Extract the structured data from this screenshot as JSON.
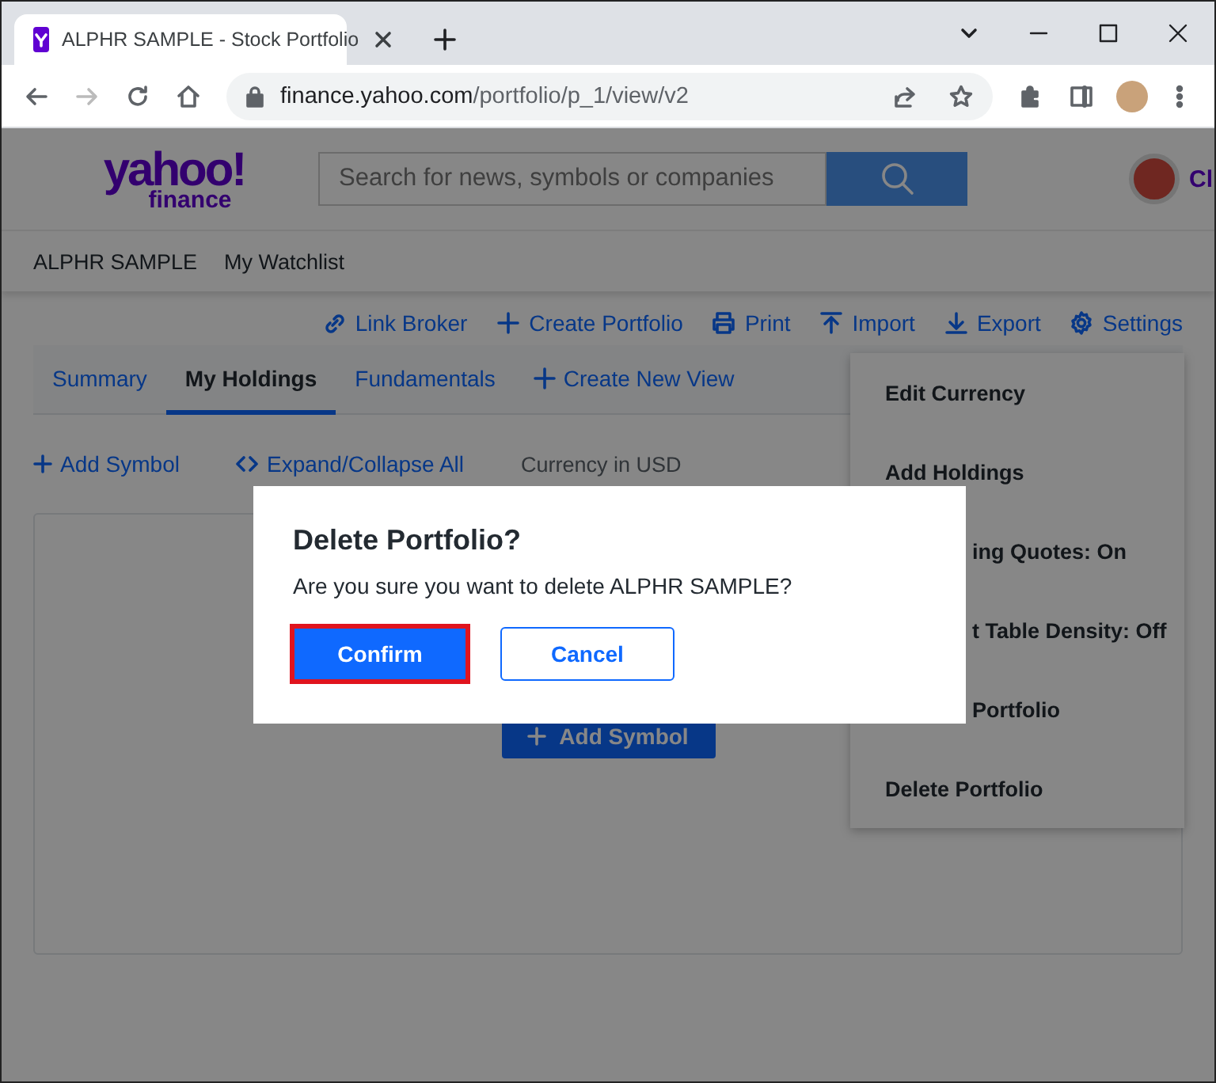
{
  "browser": {
    "tab_title": "ALPHR SAMPLE - Stock Portfolio",
    "url_host": "finance.yahoo.com",
    "url_path": "/portfolio/p_1/view/v2"
  },
  "header": {
    "logo_word": "yahoo!",
    "logo_sub": "finance",
    "search": {
      "placeholder": "Search for news, symbols or companies"
    },
    "user_name": "Cl"
  },
  "nav": [
    "ALPHR SAMPLE",
    "My Watchlist"
  ],
  "actions": [
    {
      "label": "Link Broker",
      "kind": "link"
    },
    {
      "label": "Create Portfolio",
      "kind": "add"
    },
    {
      "label": "Print",
      "kind": "print"
    },
    {
      "label": "Import",
      "kind": "import"
    },
    {
      "label": "Export",
      "kind": "export"
    },
    {
      "label": "Settings",
      "kind": "settings"
    }
  ],
  "view_tabs": [
    {
      "label": "Summary",
      "selected": false,
      "kind": "tab"
    },
    {
      "label": "My Holdings",
      "selected": true,
      "kind": "tab"
    },
    {
      "label": "Fundamentals",
      "selected": false,
      "kind": "tab"
    },
    {
      "label": "Create New View",
      "selected": false,
      "kind": "add"
    }
  ],
  "toolbar": {
    "add_symbol": "Add Symbol",
    "expand": "Expand/Collapse All",
    "currency": "Currency in USD"
  },
  "empty_state": {
    "button": "Add Symbol"
  },
  "settings_menu": [
    {
      "label": "Edit Currency",
      "kind": "full"
    },
    {
      "label": "Add Holdings",
      "kind": "full"
    },
    {
      "label": "ing Quotes: On",
      "kind": "clipped"
    },
    {
      "label": "t Table Density: Off",
      "kind": "clipped"
    },
    {
      "label": "Portfolio",
      "kind": "clipped"
    },
    {
      "label": "Delete Portfolio",
      "kind": "full"
    }
  ],
  "dialog": {
    "title": "Delete Portfolio?",
    "message": "Are you sure you want to delete ALPHR SAMPLE?",
    "buttons": [
      {
        "label": "Confirm",
        "kind": "primary",
        "highlighted": true
      },
      {
        "label": "Cancel",
        "kind": "secondary",
        "highlighted": false
      }
    ]
  }
}
